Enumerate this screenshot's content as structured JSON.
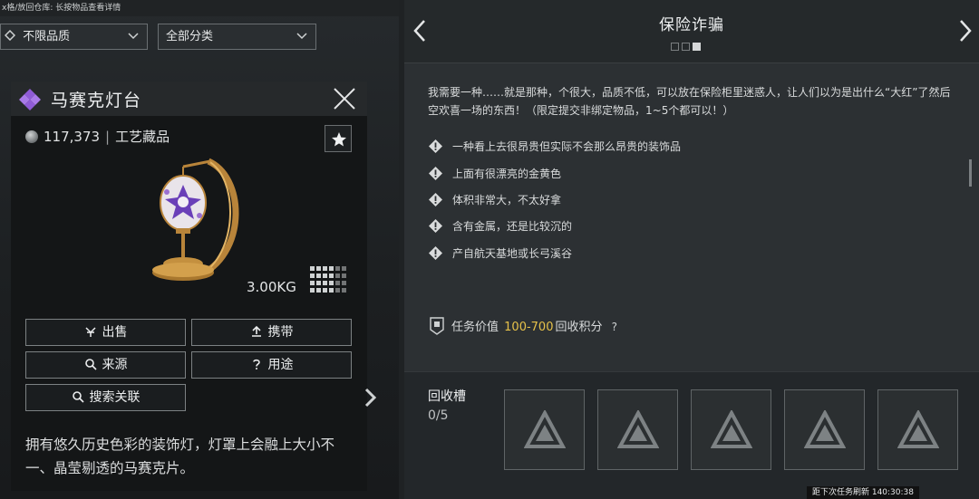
{
  "hint_bar": "x格/放回仓库: 长按物品查看详情",
  "filters": {
    "quality": "不限品质",
    "category": "全部分类"
  },
  "item": {
    "name": "马赛克灯台",
    "price": "117,373",
    "price_separator": "|",
    "type": "工艺藏品",
    "weight": "3.00KG",
    "description": "拥有悠久历史色彩的装饰灯，灯罩上会融上大小不一、晶莹剔透的马赛克片。",
    "actions": {
      "sell": "出售",
      "carry": "携带",
      "source": "来源",
      "usage": "用途",
      "search": "搜索关联"
    }
  },
  "quest": {
    "title": "保险诈骗",
    "description": "我需要一种……就是那种，个很大，品质不低，可以放在保险柜里迷惑人，让人们以为是出什么“大红”了然后空欢喜一场的东西！（限定提交非绑定物品，1~5个都可以！）",
    "requirements": [
      "一种看上去很昂贵但实际不会那么昂贵的装饰品",
      "上面有很漂亮的金黄色",
      "体积非常大，不太好拿",
      "含有金属，还是比较沉的",
      "产自航天基地或长弓溪谷"
    ],
    "value_label": "任务价值",
    "value_range": "100-700",
    "value_unit": "回收积分",
    "help": "?",
    "recycle_label": "回收槽",
    "recycle_count": "0/5",
    "refresh": "距下次任务刷新 140:30:38"
  },
  "colors": {
    "accent_gold": "#e6c14a",
    "rarity_purple": "#8f5bd6"
  },
  "icons": [
    "rarity-diamond-icon",
    "close-icon",
    "coin-icon",
    "star-icon",
    "warning-icon",
    "chevron-left-icon",
    "chevron-right-icon",
    "recycle-slot-icon"
  ]
}
